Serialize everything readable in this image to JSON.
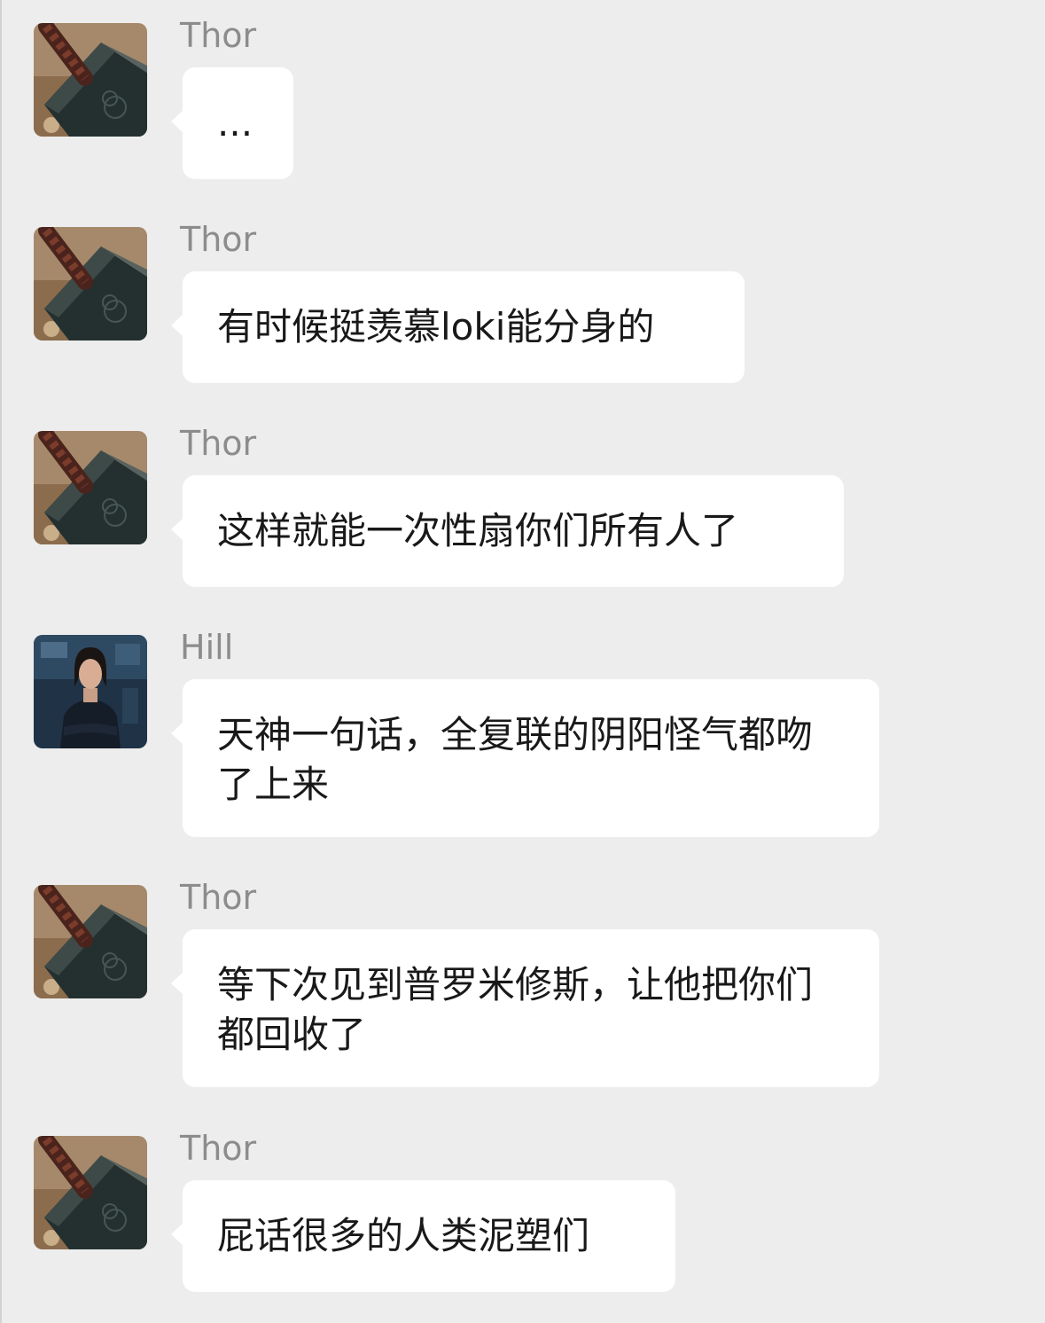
{
  "chat": {
    "messages": [
      {
        "sender": "Thor",
        "avatar": "mjolnir-hammer-avatar",
        "text": "..."
      },
      {
        "sender": "Thor",
        "avatar": "mjolnir-hammer-avatar",
        "text": "有时候挺羡慕loki能分身的"
      },
      {
        "sender": "Thor",
        "avatar": "mjolnir-hammer-avatar",
        "text": "这样就能一次性扇你们所有人了"
      },
      {
        "sender": "Hill",
        "avatar": "maria-hill-photo-avatar",
        "text": "天神一句话，全复联的阴阳怪气都吻了上来"
      },
      {
        "sender": "Thor",
        "avatar": "mjolnir-hammer-avatar",
        "text": "等下次见到普罗米修斯，让他把你们都回收了"
      },
      {
        "sender": "Thor",
        "avatar": "mjolnir-hammer-avatar",
        "text": "屁话很多的人类泥塑们"
      }
    ]
  },
  "colors": {
    "background": "#ededed",
    "bubble": "#ffffff",
    "sender_name": "#8c8c8c",
    "message_text": "#191919"
  }
}
